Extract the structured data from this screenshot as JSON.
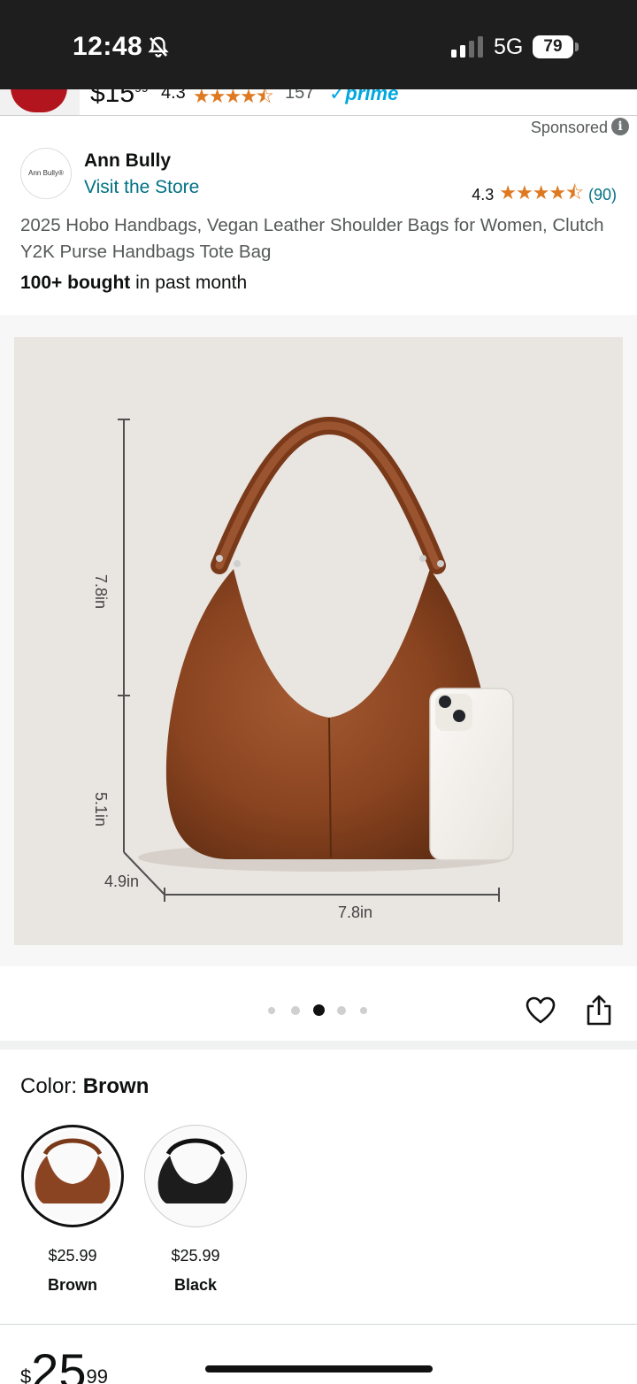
{
  "status_bar": {
    "time": "12:48",
    "network": "5G",
    "battery": "79",
    "icons": [
      "bell-slash-icon",
      "signal-icon"
    ]
  },
  "sticky": {
    "price_whole": "$15",
    "price_fraction": "99",
    "rating": "4.3",
    "review_count": "157",
    "prime": "✓prime"
  },
  "sponsored": "Sponsored",
  "brand": {
    "logo_text": "Ann Bully®",
    "name": "Ann Bully",
    "store_link": "Visit the Store"
  },
  "rating": {
    "value": "4.3",
    "stars": "★★★★⯪",
    "count": "(90)"
  },
  "product": {
    "title": "2025 Hobo Handbags, Vegan Leather Shoulder Bags for Women, Clutch Y2K Purse Handbags Tote Bag",
    "bought_bold": "100+ bought",
    "bought_rest": " in past month"
  },
  "gallery": {
    "dimensions": {
      "height_top": "7.8in",
      "height_bottom": "5.1in",
      "depth": "4.9in",
      "width": "7.8in"
    },
    "dot_count": 5,
    "active_dot": 3
  },
  "color": {
    "label": "Color: ",
    "selected": "Brown",
    "options": [
      {
        "name": "Brown",
        "price": "$25.99",
        "selected": true
      },
      {
        "name": "Black",
        "price": "$25.99",
        "selected": false
      }
    ]
  },
  "bottom_price": {
    "symbol": "$",
    "whole": "25",
    "fraction": "99"
  },
  "colors": {
    "link": "#007185",
    "star": "#de7921",
    "bag_brown": "#8b4422",
    "bag_black": "#1c1c1c"
  }
}
